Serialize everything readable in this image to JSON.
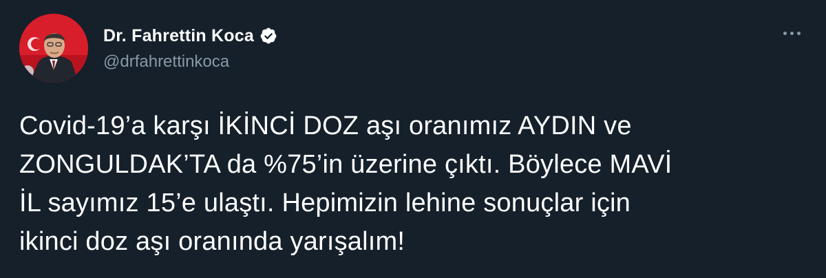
{
  "author": {
    "display_name": "Dr. Fahrettin Koca",
    "handle": "@drfahrettinkoca",
    "verified": true,
    "avatar_icon": "profile-photo"
  },
  "tweet": {
    "lines": [
      "Covid-19’a karşı İKİNCİ DOZ aşı oranımız AYDIN ve",
      "ZONGULDAK’TA da %75’in üzerine çıktı. Böylece MAVİ",
      "İL sayımız 15’e ulaştı. Hepimizin lehine sonuçlar için",
      "ikinci doz aşı oranında yarışalım!"
    ]
  },
  "menu": {
    "icon": "more-options-icon"
  },
  "colors": {
    "background": "#15202b",
    "text_primary": "#ffffff",
    "text_secondary": "#8899a6",
    "verified_badge": "#ffffff",
    "avatar_flag": "#e30a17"
  }
}
